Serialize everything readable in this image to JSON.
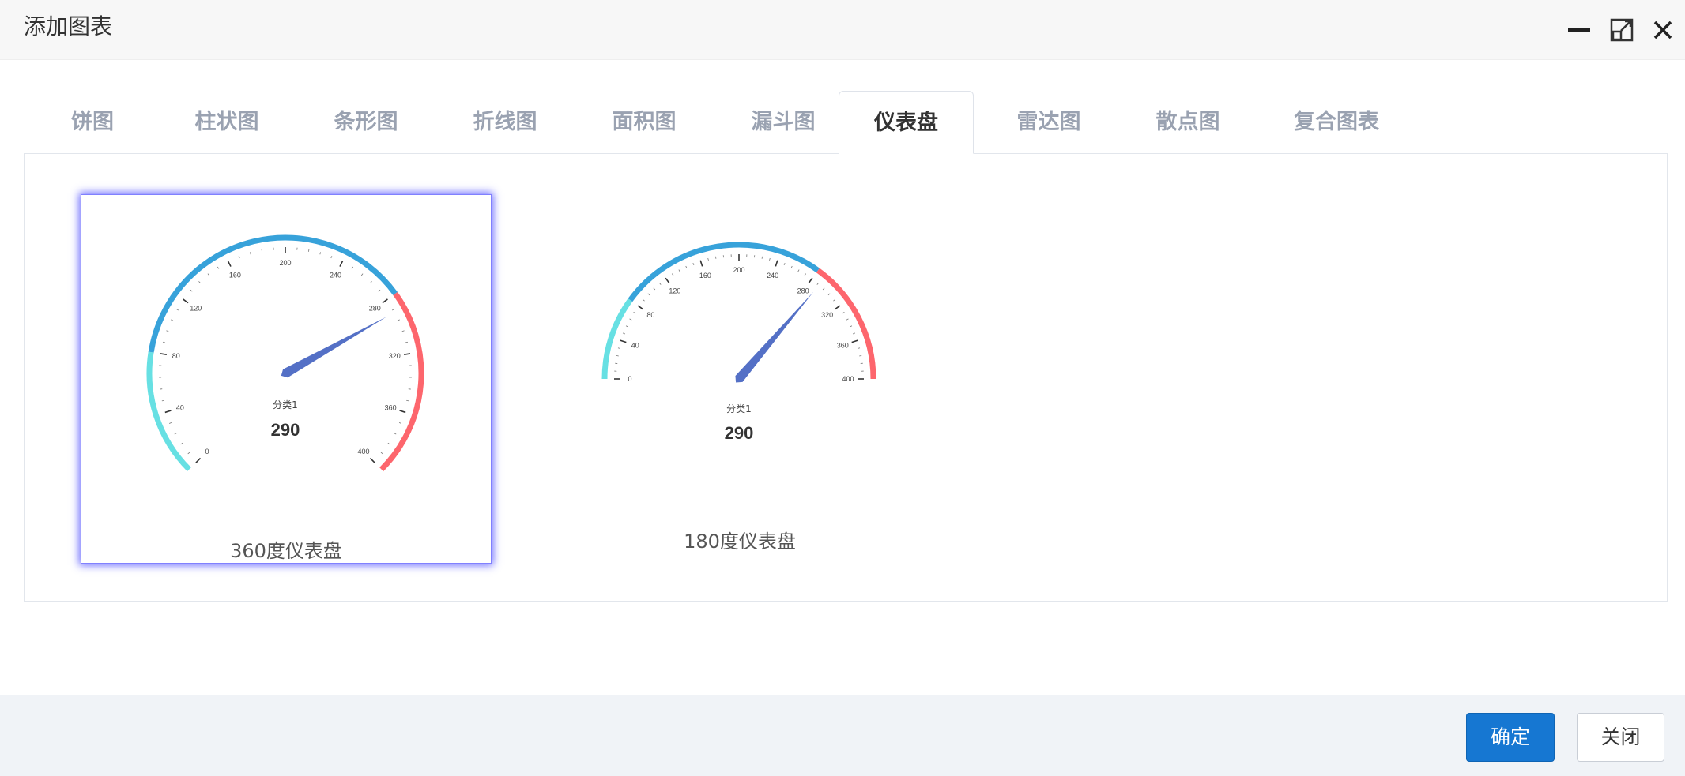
{
  "window": {
    "title": "添加图表",
    "controls": [
      "minimize-icon",
      "maximize-icon",
      "close-icon"
    ]
  },
  "tabs": [
    {
      "label": "饼图",
      "active": false
    },
    {
      "label": "柱状图",
      "active": false
    },
    {
      "label": "条形图",
      "active": false
    },
    {
      "label": "折线图",
      "active": false
    },
    {
      "label": "面积图",
      "active": false
    },
    {
      "label": "漏斗图",
      "active": false
    },
    {
      "label": "仪表盘",
      "active": true
    },
    {
      "label": "雷达图",
      "active": false
    },
    {
      "label": "散点图",
      "active": false
    },
    {
      "label": "复合图表",
      "active": false
    }
  ],
  "chart_options": [
    {
      "label": "360度仪表盘",
      "selected": true
    },
    {
      "label": "180度仪表盘",
      "selected": false
    }
  ],
  "chart_data": [
    {
      "type": "gauge",
      "variant": "360",
      "category": "分类1",
      "value": 290,
      "value_text": "290",
      "min": 0,
      "max": 400,
      "tick_labels": [
        "0",
        "40",
        "80",
        "120",
        "160",
        "200",
        "240",
        "280",
        "320",
        "360",
        "400"
      ],
      "color_bands": [
        {
          "to": 0.2,
          "color": "#67e0e3"
        },
        {
          "to": 0.7,
          "color": "#37a2da"
        },
        {
          "to": 1.0,
          "color": "#fd666d"
        }
      ],
      "pointer_color": "#5470c6"
    },
    {
      "type": "gauge",
      "variant": "180",
      "category": "分类1",
      "value": 290,
      "value_text": "290",
      "min": 0,
      "max": 400,
      "tick_labels": [
        "0",
        "40",
        "80",
        "120",
        "160",
        "200",
        "240",
        "280",
        "320",
        "360",
        "400"
      ],
      "color_bands": [
        {
          "to": 0.2,
          "color": "#67e0e3"
        },
        {
          "to": 0.7,
          "color": "#37a2da"
        },
        {
          "to": 1.0,
          "color": "#fd666d"
        }
      ],
      "pointer_color": "#5470c6"
    }
  ],
  "footer": {
    "confirm_label": "确定",
    "close_label": "关闭"
  },
  "colors": {
    "primary": "#1677d2",
    "selection_glow": "#8080ff"
  }
}
